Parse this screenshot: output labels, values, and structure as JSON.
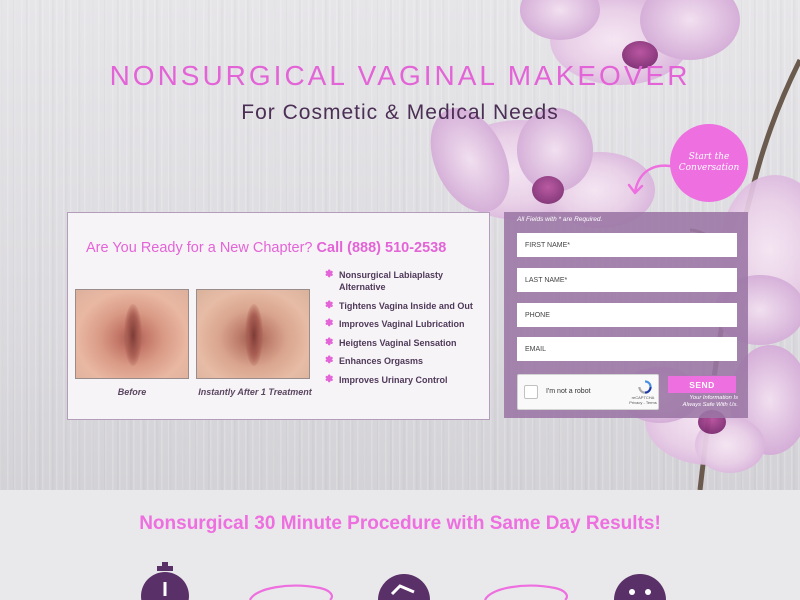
{
  "hero": {
    "title": "NONSURGICAL VAGINAL MAKEOVER",
    "subtitle": "For Cosmetic & Medical Needs",
    "badge_line1": "Start the",
    "badge_line2": "Conversation"
  },
  "info": {
    "headline": "Are You Ready for a New Chapter?",
    "call": "Call (888) 510-2538",
    "before_caption": "Before",
    "after_caption": "Instantly After 1 Treatment",
    "benefits": [
      "Nonsurgical Labiaplasty Alternative",
      "Tightens Vagina Inside and Out",
      "Improves Vaginal Lubrication",
      "Heigtens Vaginal Sensation",
      "Enhances Orgasms",
      "Improves Urinary Control"
    ]
  },
  "form": {
    "note": "All Fields with * are Required.",
    "first_name_placeholder": "FIRST NAME*",
    "last_name_placeholder": "LAST NAME*",
    "phone_placeholder": "PHONE",
    "email_placeholder": "EMAIL",
    "captcha_label": "I'm not a robot",
    "captcha_brand": "reCAPTCHA",
    "captcha_links": "Privacy - Terms",
    "send_label": "SEND",
    "secure_line1": "Your Information Is",
    "secure_line2": "Always Safe With Us."
  },
  "lower": {
    "title": "Nonsurgical 30 Minute Procedure with Same Day Results!"
  },
  "colors": {
    "accent_pink": "#ee6fe0",
    "title_pink": "#e364d7",
    "dark_purple": "#4b2f55",
    "form_purple": "#9b76a5"
  },
  "icons": [
    "flower-bullet-icon",
    "stopwatch-icon",
    "checkmark-circle-icon",
    "smiley-icon",
    "curved-arrow-icon",
    "recaptcha-icon"
  ]
}
